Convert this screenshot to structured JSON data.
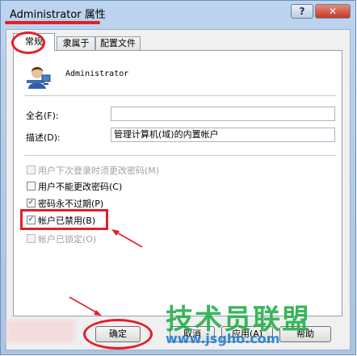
{
  "window": {
    "title": "Administrator 属性",
    "help_label": "?",
    "close_label": "✕"
  },
  "tabs": [
    {
      "label": "常规",
      "active": true
    },
    {
      "label": "隶属于",
      "active": false
    },
    {
      "label": "配置文件",
      "active": false
    }
  ],
  "user": {
    "name": "Administrator",
    "icon": "user-icon"
  },
  "fields": {
    "fullname": {
      "label": "全名(F):",
      "value": ""
    },
    "description": {
      "label": "描述(D):",
      "value": "管理计算机(域)的内置帐户"
    }
  },
  "checkboxes": [
    {
      "label": "用户下次登录时须更改密码(M)",
      "checked": false,
      "disabled": true
    },
    {
      "label": "用户不能更改密码(C)",
      "checked": false,
      "disabled": false
    },
    {
      "label": "密码永不过期(P)",
      "checked": true,
      "disabled": false
    },
    {
      "label": "帐户已禁用(B)",
      "checked": true,
      "disabled": false
    },
    {
      "label": "帐户已锁定(O)",
      "checked": false,
      "disabled": true
    }
  ],
  "buttons": {
    "ok": "确定",
    "cancel": "取消",
    "apply": "应用(A)",
    "help": "帮助"
  },
  "watermark": {
    "brand": "技术员联盟",
    "url": "www.jsgho.com"
  },
  "colors": {
    "highlight": "#e41e2a",
    "watermark_green": "#22b04a"
  }
}
